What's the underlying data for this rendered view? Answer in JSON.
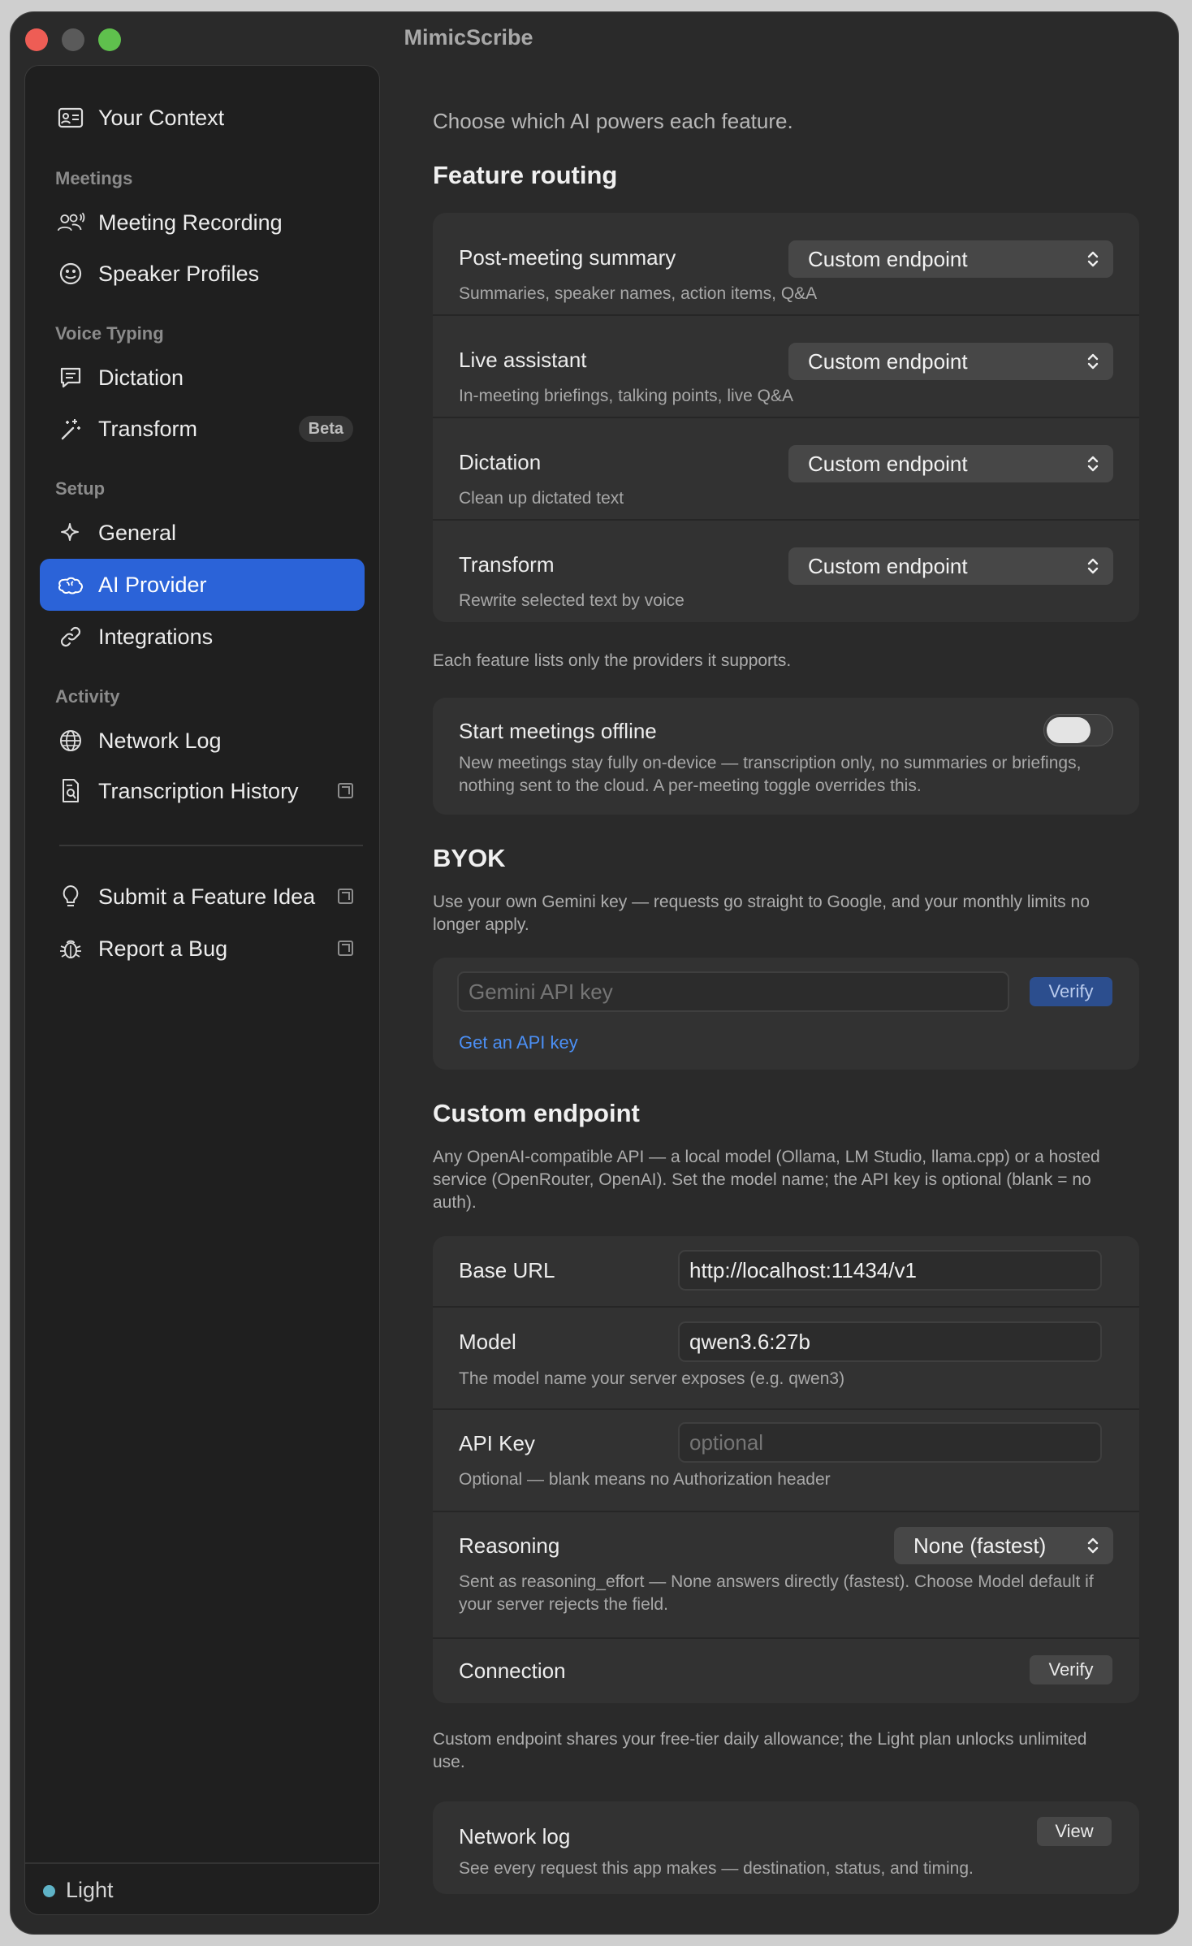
{
  "app": {
    "title": "MimicScribe"
  },
  "sidebar": {
    "top_item": {
      "label": "Your Context",
      "icon": "id-card-icon"
    },
    "sections": [
      {
        "heading": "Meetings",
        "items": [
          {
            "label": "Meeting Recording",
            "icon": "people-wave-icon"
          },
          {
            "label": "Speaker Profiles",
            "icon": "face-icon"
          }
        ]
      },
      {
        "heading": "Voice Typing",
        "items": [
          {
            "label": "Dictation",
            "icon": "message-icon"
          },
          {
            "label": "Transform",
            "icon": "magic-wand-icon",
            "badge": "Beta"
          }
        ]
      },
      {
        "heading": "Setup",
        "items": [
          {
            "label": "General",
            "icon": "sparkle-icon"
          },
          {
            "label": "AI Provider",
            "icon": "brain-icon",
            "active": true
          },
          {
            "label": "Integrations",
            "icon": "link-icon"
          }
        ]
      },
      {
        "heading": "Activity",
        "items": [
          {
            "label": "Network Log",
            "icon": "globe-icon"
          },
          {
            "label": "Transcription History",
            "icon": "document-search-icon",
            "external": true
          }
        ]
      }
    ],
    "extra_items": [
      {
        "label": "Submit a Feature Idea",
        "icon": "lightbulb-icon",
        "external": true
      },
      {
        "label": "Report a Bug",
        "icon": "bug-icon",
        "external": true
      }
    ],
    "footer": {
      "plan_label": "Light",
      "dot_color": "#5fb3c7"
    }
  },
  "main": {
    "intro": "Choose which AI powers each feature.",
    "feature_routing": {
      "heading": "Feature routing",
      "rows": [
        {
          "title": "Post-meeting summary",
          "subtitle": "Summaries, speaker names, action items, Q&A",
          "value": "Custom endpoint"
        },
        {
          "title": "Live assistant",
          "subtitle": "In-meeting briefings, talking points, live Q&A",
          "value": "Custom endpoint"
        },
        {
          "title": "Dictation",
          "subtitle": "Clean up dictated text",
          "value": "Custom endpoint"
        },
        {
          "title": "Transform",
          "subtitle": "Rewrite selected text by voice",
          "value": "Custom endpoint"
        }
      ],
      "note": "Each feature lists only the providers it supports."
    },
    "offline": {
      "title": "Start meetings offline",
      "description": "New meetings stay fully on-device — transcription only, no summaries or briefings, nothing sent to the cloud. A per-meeting toggle overrides this.",
      "enabled": false
    },
    "byok": {
      "heading": "BYOK",
      "description": "Use your own Gemini key — requests go straight to Google, and your monthly limits no longer apply.",
      "key_placeholder": "Gemini API key",
      "verify_label": "Verify",
      "link_label": "Get an API key"
    },
    "custom_endpoint": {
      "heading": "Custom endpoint",
      "description": "Any OpenAI-compatible API — a local model (Ollama, LM Studio, llama.cpp) or a hosted service (OpenRouter, OpenAI). Set the model name; the API key is optional (blank = no auth).",
      "base_url": {
        "label": "Base URL",
        "value": "http://localhost:11434/v1"
      },
      "model": {
        "label": "Model",
        "value": "qwen3.6:27b",
        "hint": "The model name your server exposes (e.g. qwen3)"
      },
      "api_key": {
        "label": "API Key",
        "placeholder": "optional",
        "hint": "Optional — blank means no Authorization header"
      },
      "reasoning": {
        "label": "Reasoning",
        "value": "None (fastest)",
        "hint": "Sent as reasoning_effort — None answers directly (fastest). Choose Model default if your server rejects the field."
      },
      "connection": {
        "label": "Connection",
        "verify_label": "Verify"
      },
      "note": "Custom endpoint shares your free-tier daily allowance; the Light plan unlocks unlimited use."
    },
    "network_log": {
      "title": "Network log",
      "description": "See every request this app makes — destination, status, and timing.",
      "button_label": "View"
    }
  }
}
